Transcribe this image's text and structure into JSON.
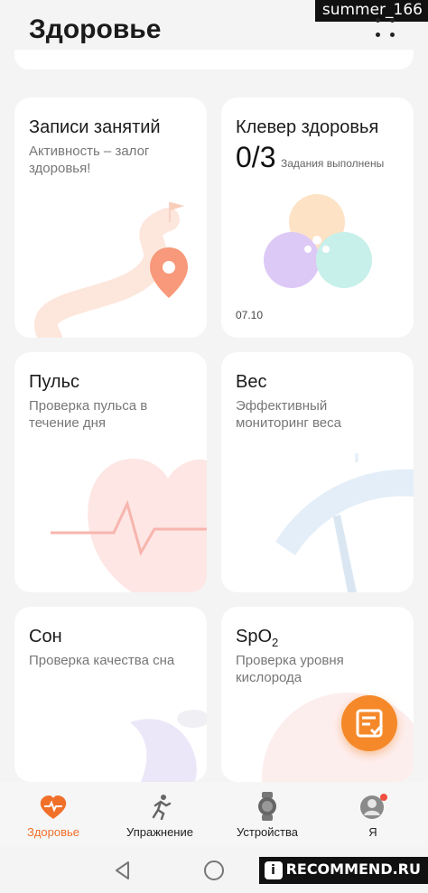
{
  "watermark": {
    "top": "summer_166",
    "bottom": "RECOMMEND.RU",
    "bottom_icon": "i"
  },
  "header": {
    "title": "Здоровье"
  },
  "cards": {
    "activity": {
      "title": "Записи занятий",
      "subtitle": "Активность – залог здоровья!"
    },
    "clover": {
      "title": "Клевер здоровья",
      "count": "0/3",
      "note": "Задания выполнены",
      "date": "07.10"
    },
    "pulse": {
      "title": "Пульс",
      "subtitle": "Проверка пульса в течение дня"
    },
    "weight": {
      "title": "Вес",
      "subtitle": "Эффективный мониторинг веса"
    },
    "sleep": {
      "title": "Сон",
      "subtitle": "Проверка качества сна"
    },
    "spo2": {
      "title": "SpO",
      "title_sub": "2",
      "subtitle": "Проверка уровня кислорода"
    }
  },
  "nav": {
    "items": [
      {
        "label": "Здоровье",
        "icon": "heart-pulse-icon",
        "active": true
      },
      {
        "label": "Упражнение",
        "icon": "running-icon",
        "active": false
      },
      {
        "label": "Устройства",
        "icon": "watch-icon",
        "active": false
      },
      {
        "label": "Я",
        "icon": "profile-icon",
        "active": false
      }
    ]
  },
  "colors": {
    "accent": "#f0702a",
    "fab": "#f5892a"
  }
}
